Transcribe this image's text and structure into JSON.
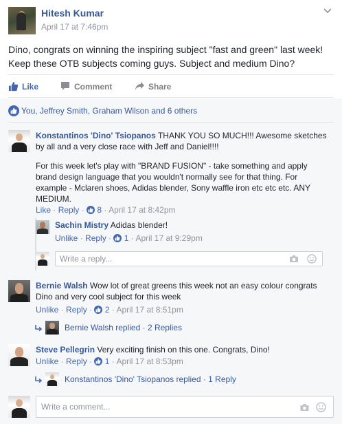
{
  "post": {
    "author": "Hitesh Kumar",
    "time": "April 17 at 7:46pm",
    "text": "Dino, congrats on winning the inspiring subject \"fast and green\" last week! Keep these OTB subjects coming guys. Subject and medium Dino?"
  },
  "actions": {
    "like": "Like",
    "comment": "Comment",
    "share": "Share"
  },
  "likes_summary": {
    "you": "You",
    "names": ", Jeffrey Smith, Graham Wilson and 6 others"
  },
  "comments": [
    {
      "author": "Konstantinos 'Dino' Tsiopanos",
      "text1": "THANK YOU SO MUCH!!! Awesome sketches by all and a very close race with Jeff and Daniel!!!!",
      "text2": "For this week let's play with \"BRAND FUSION\" - take something and apply brand design language that you wouldn't normally see for that thing. For example - Mclaren shoes, Adidas blender, Sony waffle iron etc etc etc. ANY MEDIUM.",
      "like_label": "Like",
      "reply_label": "Reply",
      "likes": "8",
      "time": "April 17 at 8:42pm",
      "replies": [
        {
          "author": "Sachin Mistry",
          "text": "Adidas blender!",
          "unlike_label": "Unlike",
          "reply_label": "Reply",
          "likes": "1",
          "time": "April 17 at 9:29pm"
        }
      ],
      "reply_placeholder": "Write a reply..."
    },
    {
      "author": "Bernie Walsh",
      "text": "Wow lot of great greens this week not an easy colour congrats Dino and very cool subject for this week",
      "unlike_label": "Unlike",
      "reply_label": "Reply",
      "likes": "2",
      "time": "April 17 at 8:51pm",
      "replied_text": "Bernie Walsh replied · 2 Replies"
    },
    {
      "author": "Steve Pellegrin",
      "text": "Very exciting finish on this one. Congrats, Dino!",
      "unlike_label": "Unlike",
      "reply_label": "Reply",
      "likes": "1",
      "time": "April 17 at 8:53pm",
      "replied_text": "Konstantinos 'Dino' Tsiopanos replied · 1 Reply"
    }
  ],
  "comment_box": {
    "placeholder": "Write a comment..."
  },
  "colors": {
    "link": "#365899",
    "accent": "#4267b2",
    "muted": "#90949c",
    "ufi_bg": "#f6f7f9"
  },
  "icons": [
    "chevron-down-icon",
    "thumbs-up-icon",
    "comment-icon",
    "share-icon",
    "reply-arrow-icon",
    "camera-icon",
    "emoji-icon"
  ]
}
